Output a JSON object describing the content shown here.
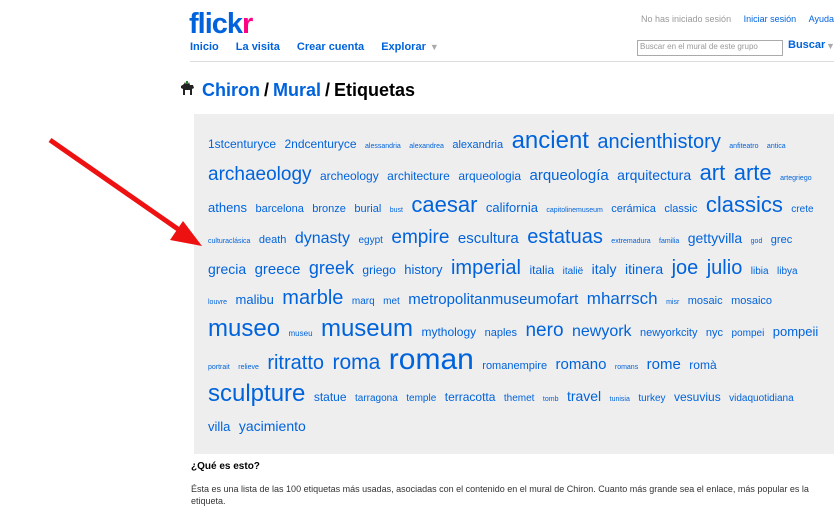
{
  "logo": {
    "part1": "flick",
    "part2": "r"
  },
  "nav": [
    {
      "label": "Inicio"
    },
    {
      "label": "La visita"
    },
    {
      "label": "Crear cuenta"
    },
    {
      "label": "Explorar"
    }
  ],
  "topright": {
    "status": "No has iniciado sesión",
    "login": "Iniciar sesión",
    "help": "Ayuda"
  },
  "search": {
    "placeholder": "Buscar en el mural de este grupo",
    "button": "Buscar"
  },
  "breadcrumb": {
    "group": "Chiron",
    "mural": "Mural",
    "current": "Etiquetas",
    "sep": "/"
  },
  "tags": [
    {
      "t": "1stcenturyce",
      "s": 12
    },
    {
      "t": "2ndcenturyce",
      "s": 12
    },
    {
      "t": "alessandria",
      "s": 7
    },
    {
      "t": "alexandrea",
      "s": 7
    },
    {
      "t": "alexandria",
      "s": 11
    },
    {
      "t": "ancient",
      "s": 24
    },
    {
      "t": "ancienthistory",
      "s": 20
    },
    {
      "t": "anfiteatro",
      "s": 7
    },
    {
      "t": "antica",
      "s": 7
    },
    {
      "t": "archaeology",
      "s": 19
    },
    {
      "t": "archeology",
      "s": 12
    },
    {
      "t": "architecture",
      "s": 12
    },
    {
      "t": "arqueologia",
      "s": 12
    },
    {
      "t": "arqueología",
      "s": 15
    },
    {
      "t": "arquitectura",
      "s": 14
    },
    {
      "t": "art",
      "s": 22
    },
    {
      "t": "arte",
      "s": 22
    },
    {
      "t": "artegriego",
      "s": 7
    },
    {
      "t": "athens",
      "s": 13
    },
    {
      "t": "barcelona",
      "s": 11
    },
    {
      "t": "bronze",
      "s": 11
    },
    {
      "t": "burial",
      "s": 11
    },
    {
      "t": "bust",
      "s": 7
    },
    {
      "t": "caesar",
      "s": 22
    },
    {
      "t": "california",
      "s": 13
    },
    {
      "t": "capitolinemuseum",
      "s": 7
    },
    {
      "t": "cerámica",
      "s": 11
    },
    {
      "t": "classic",
      "s": 11
    },
    {
      "t": "classics",
      "s": 22
    },
    {
      "t": "crete",
      "s": 10
    },
    {
      "t": "culturaclásica",
      "s": 7
    },
    {
      "t": "death",
      "s": 11
    },
    {
      "t": "dynasty",
      "s": 16
    },
    {
      "t": "egypt",
      "s": 10
    },
    {
      "t": "empire",
      "s": 19
    },
    {
      "t": "escultura",
      "s": 15
    },
    {
      "t": "estatuas",
      "s": 20
    },
    {
      "t": "extremadura",
      "s": 7
    },
    {
      "t": "familia",
      "s": 7
    },
    {
      "t": "gettyvilla",
      "s": 14
    },
    {
      "t": "god",
      "s": 7
    },
    {
      "t": "grec",
      "s": 11
    },
    {
      "t": "grecia",
      "s": 14
    },
    {
      "t": "greece",
      "s": 15
    },
    {
      "t": "greek",
      "s": 18
    },
    {
      "t": "griego",
      "s": 12
    },
    {
      "t": "history",
      "s": 13
    },
    {
      "t": "imperial",
      "s": 20
    },
    {
      "t": "italia",
      "s": 12
    },
    {
      "t": "italië",
      "s": 10
    },
    {
      "t": "italy",
      "s": 14
    },
    {
      "t": "itinera",
      "s": 14
    },
    {
      "t": "joe",
      "s": 20
    },
    {
      "t": "julio",
      "s": 20
    },
    {
      "t": "libia",
      "s": 10
    },
    {
      "t": "libya",
      "s": 10
    },
    {
      "t": "louvre",
      "s": 7
    },
    {
      "t": "malibu",
      "s": 13
    },
    {
      "t": "marble",
      "s": 20
    },
    {
      "t": "marq",
      "s": 10
    },
    {
      "t": "met",
      "s": 10
    },
    {
      "t": "metropolitanmuseumofart",
      "s": 15
    },
    {
      "t": "mharrsch",
      "s": 17
    },
    {
      "t": "misr",
      "s": 7
    },
    {
      "t": "mosaic",
      "s": 11
    },
    {
      "t": "mosaico",
      "s": 11
    },
    {
      "t": "museo",
      "s": 24
    },
    {
      "t": "museu",
      "s": 8
    },
    {
      "t": "museum",
      "s": 24
    },
    {
      "t": "mythology",
      "s": 12
    },
    {
      "t": "naples",
      "s": 11
    },
    {
      "t": "nero",
      "s": 19
    },
    {
      "t": "newyork",
      "s": 16
    },
    {
      "t": "newyorkcity",
      "s": 11
    },
    {
      "t": "nyc",
      "s": 11
    },
    {
      "t": "pompei",
      "s": 10
    },
    {
      "t": "pompeii",
      "s": 13
    },
    {
      "t": "portrait",
      "s": 7
    },
    {
      "t": "relieve",
      "s": 7
    },
    {
      "t": "ritratto",
      "s": 20
    },
    {
      "t": "roma",
      "s": 21
    },
    {
      "t": "roman",
      "s": 30
    },
    {
      "t": "romanempire",
      "s": 11
    },
    {
      "t": "romano",
      "s": 15
    },
    {
      "t": "romans",
      "s": 7
    },
    {
      "t": "rome",
      "s": 15
    },
    {
      "t": "romà",
      "s": 12
    },
    {
      "t": "sculpture",
      "s": 24
    },
    {
      "t": "statue",
      "s": 12
    },
    {
      "t": "tarragona",
      "s": 10
    },
    {
      "t": "temple",
      "s": 10
    },
    {
      "t": "terracotta",
      "s": 12
    },
    {
      "t": "themet",
      "s": 10
    },
    {
      "t": "tomb",
      "s": 7
    },
    {
      "t": "travel",
      "s": 14
    },
    {
      "t": "tunisia",
      "s": 7
    },
    {
      "t": "turkey",
      "s": 10
    },
    {
      "t": "vesuvius",
      "s": 12
    },
    {
      "t": "vidaquotidiana",
      "s": 10
    },
    {
      "t": "villa",
      "s": 13
    },
    {
      "t": "yacimiento",
      "s": 14
    }
  ],
  "whatis": {
    "heading": "¿Qué es esto?",
    "text": "Ésta es una lista de las 100 etiquetas más usadas, asociadas con el contenido en el mural de Chiron. Cuanto más grande sea el enlace, más popular es la etiqueta."
  },
  "colors": {
    "link": "#0063dc",
    "brand_pink": "#ff0084",
    "cloud_bg": "#eeeeee",
    "arrow": "#ee1111"
  }
}
